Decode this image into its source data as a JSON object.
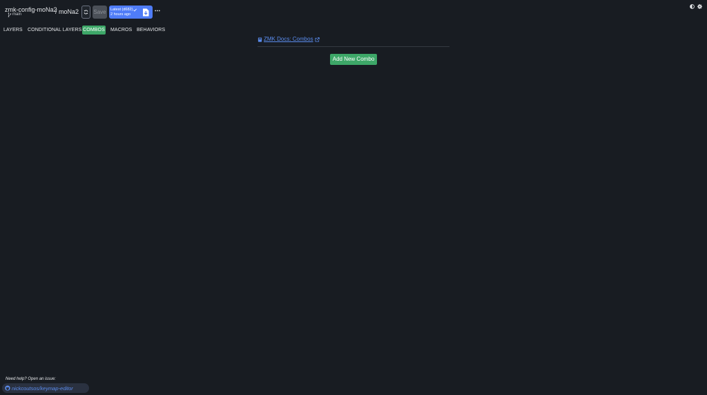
{
  "header": {
    "repo_name": "zmk-config-moNa2",
    "branch": "main",
    "keyboard": "/ moNa2",
    "save_label": "Save",
    "build": {
      "status": "Latest (d682)",
      "time": "2 hours ago"
    }
  },
  "tabs": [
    {
      "label": "LAYERS",
      "active": false
    },
    {
      "label": "CONDITIONAL LAYERS",
      "active": false
    },
    {
      "label": "COMBOS",
      "active": true
    },
    {
      "label": "MACROS",
      "active": false
    },
    {
      "label": "BEHAVIORS",
      "active": false
    }
  ],
  "main": {
    "docs_link": "ZMK Docs: Combos",
    "add_button": "Add New Combo"
  },
  "footer": {
    "help_text": "Need help? Open an issue:",
    "github_link": "nickcoutsos/keymap-editor"
  },
  "colors": {
    "background": "#181c22",
    "accent_green": "#3da768",
    "accent_blue": "#4f7cf7",
    "link": "#5b8def"
  }
}
